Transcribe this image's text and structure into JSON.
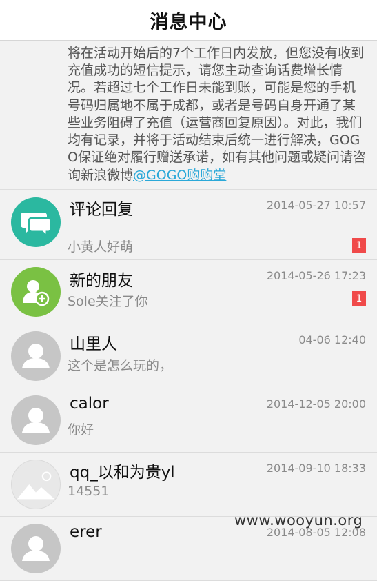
{
  "header": {
    "title": "消息中心"
  },
  "notice": {
    "text": "将在活动开始后的7个工作日内发放，但您没有收到充值成功的短信提示，请您主动查询话费增长情况。若超过七个工作日未能到账，可能是您的手机号码归属地不属于成都，或者是号码自身开通了某些业务阻碍了充值（运营商回复原因）。对此，我们均有记录，并将于活动结束后统一进行解决，GOGO保证绝对履行赠送承诺，如有其他问题或疑问请咨询新浪微博",
    "link": "@GOGO购购堂"
  },
  "messages": [
    {
      "name": "评论回复",
      "time": "2014-05-27 10:57",
      "preview": "小黄人好萌",
      "badge": "1",
      "avatar_icon": "comment-bubbles-icon",
      "avatar_color": "#2bb8a0"
    },
    {
      "name": "新的朋友",
      "time": "2014-05-26 17:23",
      "preview": "Sole关注了你",
      "badge": "1",
      "avatar_icon": "add-friend-icon",
      "avatar_color": "#7ac143"
    },
    {
      "name": "山里人",
      "time": "04-06 12:40",
      "preview": "这个是怎么玩的，",
      "avatar_icon": "default-user-icon",
      "avatar_color": "#c6c6c6"
    },
    {
      "name": "calor",
      "time": "2014-12-05 20:00",
      "preview": "你好",
      "avatar_icon": "default-user-icon",
      "avatar_color": "#c6c6c6"
    },
    {
      "name": "qq_以和为贵yl",
      "time": "2014-09-10 18:33",
      "preview": "14551",
      "avatar_icon": "placeholder-image-icon",
      "avatar_color": "#e8e8e8"
    },
    {
      "name": "erer",
      "time": "2014-08-05 12:08",
      "preview": "",
      "avatar_icon": "default-user-icon",
      "avatar_color": "#c6c6c6"
    }
  ],
  "watermark": "www.wooyun.org"
}
